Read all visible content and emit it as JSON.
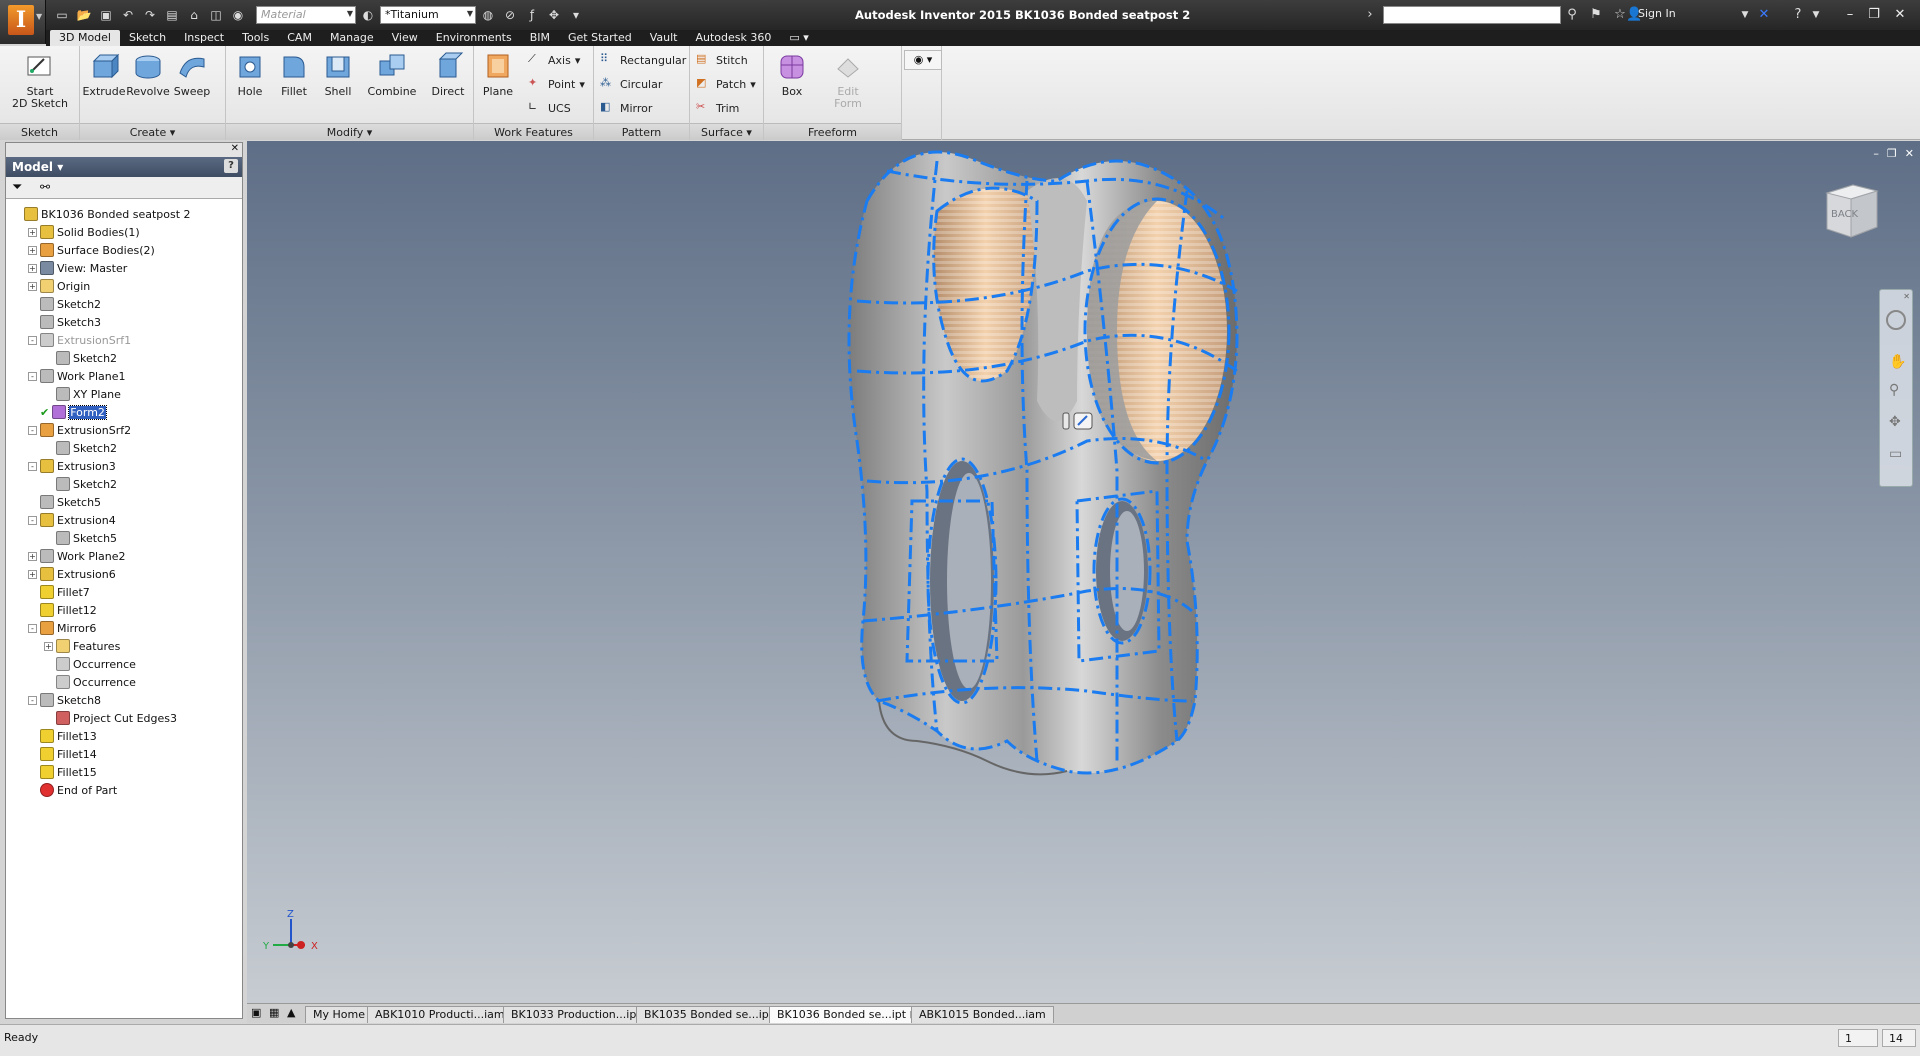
{
  "app": {
    "title": "Autodesk Inventor 2015    BK1036 Bonded seatpost 2",
    "logo_letter": "I",
    "material_placeholder": "Material",
    "appearance_value": "*Titanium",
    "sign_in": "Sign In"
  },
  "ribbon": {
    "tabs": [
      "3D Model",
      "Sketch",
      "Inspect",
      "Tools",
      "CAM",
      "Manage",
      "View",
      "Environments",
      "BIM",
      "Get Started",
      "Vault",
      "Autodesk 360"
    ],
    "active_tab": "3D Model",
    "panels": {
      "sketch": "Sketch",
      "create": "Create",
      "modify": "Modify",
      "work_features": "Work Features",
      "pattern": "Pattern",
      "surface": "Surface",
      "freeform": "Freeform"
    },
    "buttons": {
      "start_sketch_1": "Start",
      "start_sketch_2": "2D Sketch",
      "extrude": "Extrude",
      "revolve": "Revolve",
      "sweep": "Sweep",
      "hole": "Hole",
      "fillet": "Fillet",
      "shell": "Shell",
      "combine": "Combine",
      "direct": "Direct",
      "plane": "Plane",
      "axis": "Axis",
      "point": "Point",
      "ucs": "UCS",
      "rectangular": "Rectangular",
      "circular": "Circular",
      "mirror": "Mirror",
      "stitch": "Stitch",
      "patch": "Patch",
      "trim": "Trim",
      "box": "Box",
      "edit_form_1": "Edit",
      "edit_form_2": "Form"
    }
  },
  "browser": {
    "title": "Model",
    "nodes": [
      {
        "label": "BK1036 Bonded seatpost 2",
        "indent": 0,
        "expander": "",
        "icon": "part",
        "color": "#e8c040"
      },
      {
        "label": "Solid Bodies(1)",
        "indent": 1,
        "expander": "+",
        "icon": "folder",
        "color": "#e8c040"
      },
      {
        "label": "Surface Bodies(2)",
        "indent": 1,
        "expander": "+",
        "icon": "folder",
        "color": "#e8a040"
      },
      {
        "label": "View: Master",
        "indent": 1,
        "expander": "+",
        "icon": "view",
        "color": "#7a8aa0"
      },
      {
        "label": "Origin",
        "indent": 1,
        "expander": "+",
        "icon": "folder",
        "color": "#f0d070"
      },
      {
        "label": "Sketch2",
        "indent": 1,
        "expander": "",
        "icon": "sketch",
        "color": "#bbbbbb"
      },
      {
        "label": "Sketch3",
        "indent": 1,
        "expander": "",
        "icon": "sketch",
        "color": "#bbbbbb"
      },
      {
        "label": "ExtrusionSrf1",
        "indent": 1,
        "expander": "-",
        "icon": "extrude",
        "color": "#cccccc",
        "gray": true
      },
      {
        "label": "Sketch2",
        "indent": 2,
        "expander": "",
        "icon": "sketch",
        "color": "#bbbbbb"
      },
      {
        "label": "Work Plane1",
        "indent": 1,
        "expander": "-",
        "icon": "plane",
        "color": "#bbbbbb"
      },
      {
        "label": "XY Plane",
        "indent": 2,
        "expander": "",
        "icon": "plane",
        "color": "#bbbbbb"
      },
      {
        "label": "Form2",
        "indent": 1,
        "expander": "",
        "icon": "form",
        "color": "#b070d8",
        "selected": true,
        "check": true
      },
      {
        "label": "ExtrusionSrf2",
        "indent": 1,
        "expander": "-",
        "icon": "extrude",
        "color": "#e8a040"
      },
      {
        "label": "Sketch2",
        "indent": 2,
        "expander": "",
        "icon": "sketch",
        "color": "#bbbbbb"
      },
      {
        "label": "Extrusion3",
        "indent": 1,
        "expander": "-",
        "icon": "extrude",
        "color": "#e8c040"
      },
      {
        "label": "Sketch2",
        "indent": 2,
        "expander": "",
        "icon": "sketch",
        "color": "#bbbbbb"
      },
      {
        "label": "Sketch5",
        "indent": 1,
        "expander": "",
        "icon": "sketch",
        "color": "#bbbbbb"
      },
      {
        "label": "Extrusion4",
        "indent": 1,
        "expander": "-",
        "icon": "extrude",
        "color": "#e8c040"
      },
      {
        "label": "Sketch5",
        "indent": 2,
        "expander": "",
        "icon": "sketch",
        "color": "#bbbbbb"
      },
      {
        "label": "Work Plane2",
        "indent": 1,
        "expander": "+",
        "icon": "plane",
        "color": "#bbbbbb"
      },
      {
        "label": "Extrusion6",
        "indent": 1,
        "expander": "+",
        "icon": "extrude",
        "color": "#e8c040"
      },
      {
        "label": "Fillet7",
        "indent": 1,
        "expander": "",
        "icon": "fillet",
        "color": "#f0d030"
      },
      {
        "label": "Fillet12",
        "indent": 1,
        "expander": "",
        "icon": "fillet",
        "color": "#f0d030"
      },
      {
        "label": "Mirror6",
        "indent": 1,
        "expander": "-",
        "icon": "mirror",
        "color": "#e8a040"
      },
      {
        "label": "Features",
        "indent": 2,
        "expander": "+",
        "icon": "folder",
        "color": "#f0d070"
      },
      {
        "label": "Occurrence",
        "indent": 2,
        "expander": "",
        "icon": "occurrence",
        "color": "#cccccc"
      },
      {
        "label": "Occurrence",
        "indent": 2,
        "expander": "",
        "icon": "occurrence",
        "color": "#cccccc"
      },
      {
        "label": "Sketch8",
        "indent": 1,
        "expander": "-",
        "icon": "sketch",
        "color": "#bbbbbb"
      },
      {
        "label": "Project Cut Edges3",
        "indent": 2,
        "expander": "",
        "icon": "project",
        "color": "#d06060"
      },
      {
        "label": "Fillet13",
        "indent": 1,
        "expander": "",
        "icon": "fillet",
        "color": "#f0d030"
      },
      {
        "label": "Fillet14",
        "indent": 1,
        "expander": "",
        "icon": "fillet",
        "color": "#f0d030"
      },
      {
        "label": "Fillet15",
        "indent": 1,
        "expander": "",
        "icon": "fillet",
        "color": "#f0d030"
      },
      {
        "label": "End of Part",
        "indent": 1,
        "expander": "",
        "icon": "end",
        "color": "#e03030"
      }
    ]
  },
  "viewport": {
    "viewcube_face": "BACK",
    "triad": {
      "z": "Z",
      "y": "Y",
      "x": "X"
    }
  },
  "doc_tabs": [
    "My Home",
    "ABK1010 Producti...iam",
    "BK1033 Production...ipt",
    "BK1035 Bonded se...ipt",
    "BK1036 Bonded se...ipt",
    "ABK1015 Bonded...iam"
  ],
  "active_doc": "BK1036 Bonded se...ipt",
  "status": {
    "text": "Ready",
    "field1": "1",
    "field2": "14"
  },
  "colors": {
    "accent": "#1e90ff",
    "wire": "#1a7cf0",
    "titanium": "#a8a8a8"
  }
}
